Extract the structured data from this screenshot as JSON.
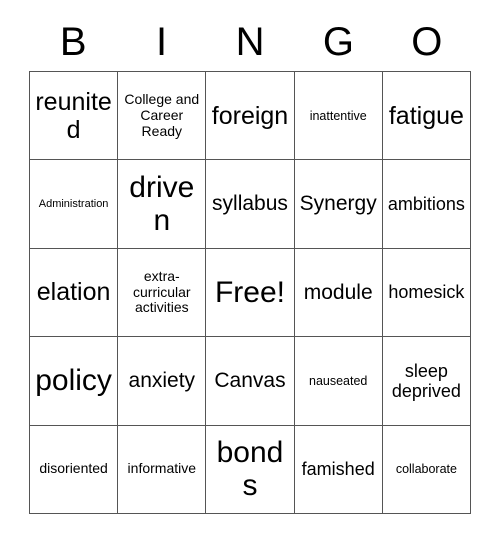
{
  "card": {
    "title_letters": [
      "B",
      "I",
      "N",
      "G",
      "O"
    ],
    "grid_size": "5x5",
    "free_space_label": "Free!",
    "border_color": "#555555",
    "text_color": "#000000",
    "background_color": "#ffffff",
    "rows": [
      [
        {
          "label": "reunited",
          "size": "lg"
        },
        {
          "label": "College and Career Ready",
          "size": "xs"
        },
        {
          "label": "foreign",
          "size": "lg"
        },
        {
          "label": "inattentive",
          "size": "xxs"
        },
        {
          "label": "fatigue",
          "size": "lg"
        }
      ],
      [
        {
          "label": "Administration",
          "size": "tiny"
        },
        {
          "label": "driven",
          "size": "xl"
        },
        {
          "label": "syllabus",
          "size": "md"
        },
        {
          "label": "Synergy",
          "size": "md"
        },
        {
          "label": "ambitions",
          "size": "sm"
        }
      ],
      [
        {
          "label": "elation",
          "size": "lg"
        },
        {
          "label": "extra-curricular activities",
          "size": "xs"
        },
        {
          "label": "Free!",
          "size": "xl"
        },
        {
          "label": "module",
          "size": "md"
        },
        {
          "label": "homesick",
          "size": "sm"
        }
      ],
      [
        {
          "label": "policy",
          "size": "xl"
        },
        {
          "label": "anxiety",
          "size": "md"
        },
        {
          "label": "Canvas",
          "size": "md"
        },
        {
          "label": "nauseated",
          "size": "xxs"
        },
        {
          "label": "sleep deprived",
          "size": "sm"
        }
      ],
      [
        {
          "label": "disoriented",
          "size": "xs"
        },
        {
          "label": "informative",
          "size": "xs"
        },
        {
          "label": "bonds",
          "size": "xl"
        },
        {
          "label": "famished",
          "size": "sm"
        },
        {
          "label": "collaborate",
          "size": "xxs"
        }
      ]
    ]
  }
}
